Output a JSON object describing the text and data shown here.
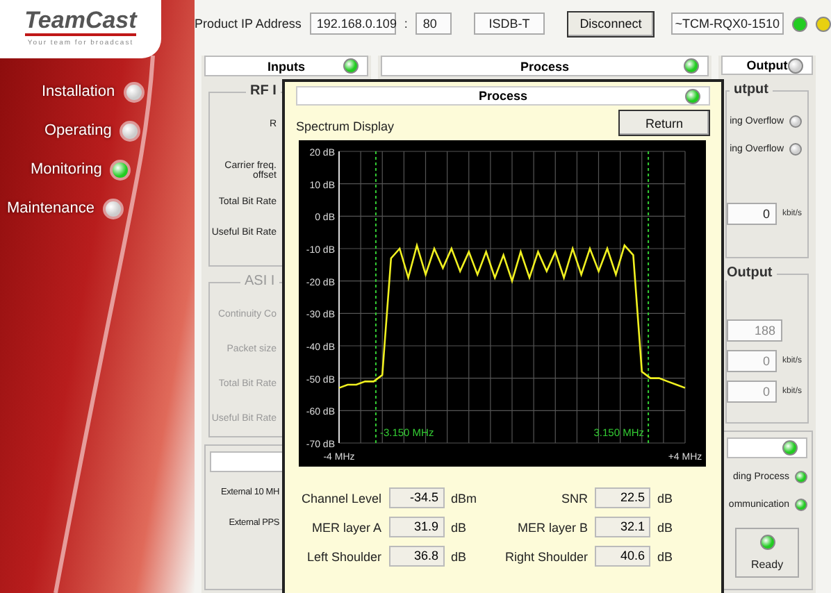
{
  "logo": {
    "name": "TeamCast",
    "tagline": "Your team for broadcast"
  },
  "nav": [
    {
      "label": "Installation",
      "selected": false
    },
    {
      "label": "Operating",
      "selected": false
    },
    {
      "label": "Monitoring",
      "selected": true
    },
    {
      "label": "Maintenance",
      "selected": false
    }
  ],
  "toolbar": {
    "ip_label": "Product IP Address",
    "ip": "192.168.0.109",
    "separator": ":",
    "port": "80",
    "standard": "ISDB-T",
    "disconnect": "Disconnect",
    "device": "~TCM-RQX0-1510",
    "status_lights": [
      {
        "color": "#22cc22"
      },
      {
        "color": "#e8d010"
      }
    ]
  },
  "inputs": {
    "title": "Inputs",
    "on": true,
    "rf_legend": "RF I",
    "rf_rows": [
      "R",
      "Carrier freq. offset",
      "Total Bit Rate",
      "Useful Bit Rate"
    ],
    "asi_legend": "ASI I",
    "asi_disabled": true,
    "asi_rows": [
      "Continuity Co",
      "Packet size",
      "Total Bit Rate",
      "Useful Bit Rate"
    ],
    "clock_rows": [
      "External 10 MH",
      "External PPS"
    ]
  },
  "process": {
    "title": "Process",
    "on": true
  },
  "output": {
    "title": "Output",
    "on": false,
    "legend": "utput",
    "flags": [
      {
        "label": "ing Overflow",
        "on": false
      },
      {
        "label": "ing Overflow",
        "on": false
      }
    ],
    "rate": {
      "value": "0",
      "unit": "kbit/s"
    },
    "legend_2": "Output",
    "fields": [
      {
        "value": "188"
      },
      {
        "value": "0",
        "unit": "kbit/s"
      },
      {
        "value": "0",
        "unit": "kbit/s"
      }
    ],
    "status_on": true,
    "status": [
      {
        "label": "ding Process",
        "on": true
      },
      {
        "label": "ommunication",
        "on": true
      }
    ],
    "ready": {
      "label": "Ready",
      "on": true
    }
  },
  "dialog": {
    "title": "Process",
    "on": true,
    "spectrum_label": "Spectrum Display",
    "return": "Return",
    "chart_data": {
      "type": "line",
      "x": [
        -4,
        -3.8,
        -3.6,
        -3.4,
        -3.2,
        -3,
        -2.8,
        -2.6,
        -2.4,
        -2.2,
        -2,
        -1.8,
        -1.6,
        -1.4,
        -1.2,
        -1,
        -0.8,
        -0.6,
        -0.4,
        -0.2,
        0,
        0.2,
        0.4,
        0.6,
        0.8,
        1,
        1.2,
        1.4,
        1.6,
        1.8,
        2,
        2.2,
        2.4,
        2.6,
        2.8,
        3,
        3.2,
        3.4,
        3.6,
        3.8,
        4
      ],
      "grid": true,
      "series": [
        {
          "color": "#f0f020",
          "values": [
            -53,
            -52,
            -52,
            -51,
            -51,
            -49,
            -13,
            -10,
            -19,
            -9,
            -18,
            -10,
            -16,
            -10,
            -17,
            -11,
            -18,
            -11,
            -19,
            -12,
            -20,
            -11,
            -19,
            -11,
            -17,
            -11,
            -19,
            -10,
            -18,
            -10,
            -17,
            -10,
            -18,
            -9,
            -12,
            -48,
            -50,
            -50,
            -51,
            -52,
            -53
          ]
        }
      ],
      "xlim": [
        -4,
        4
      ],
      "ylim": [
        -70,
        20
      ],
      "xticks": [
        {
          "value": -4,
          "label": "-4 MHz"
        },
        {
          "value": 4,
          "label": "+4 MHz"
        }
      ],
      "yticks": [
        {
          "value": 20,
          "label": "20 dB"
        },
        {
          "value": 10,
          "label": "10 dB"
        },
        {
          "value": 0,
          "label": "0 dB"
        },
        {
          "value": -10,
          "label": "-10 dB"
        },
        {
          "value": -20,
          "label": "-20 dB"
        },
        {
          "value": -30,
          "label": "-30 dB"
        },
        {
          "value": -40,
          "label": "-40 dB"
        },
        {
          "value": -50,
          "label": "-50 dB"
        },
        {
          "value": -60,
          "label": "-60 dB"
        },
        {
          "value": -70,
          "label": "-70 dB"
        }
      ],
      "ref_lines": [
        {
          "axis": "x",
          "value": -3.15,
          "label": "-3.150 MHz"
        },
        {
          "axis": "x",
          "value": 3.15,
          "label": "3.150 MHz"
        }
      ]
    },
    "measurements": [
      {
        "label": "Channel Level",
        "value": "-34.5",
        "unit": "dBm"
      },
      {
        "label": "SNR",
        "value": "22.5",
        "unit": "dB"
      },
      {
        "label": "MER layer A",
        "value": "31.9",
        "unit": "dB"
      },
      {
        "label": "MER layer B",
        "value": "32.1",
        "unit": "dB"
      },
      {
        "label": "Left Shoulder",
        "value": "36.8",
        "unit": "dB"
      },
      {
        "label": "Right Shoulder",
        "value": "40.6",
        "unit": "dB"
      }
    ]
  }
}
